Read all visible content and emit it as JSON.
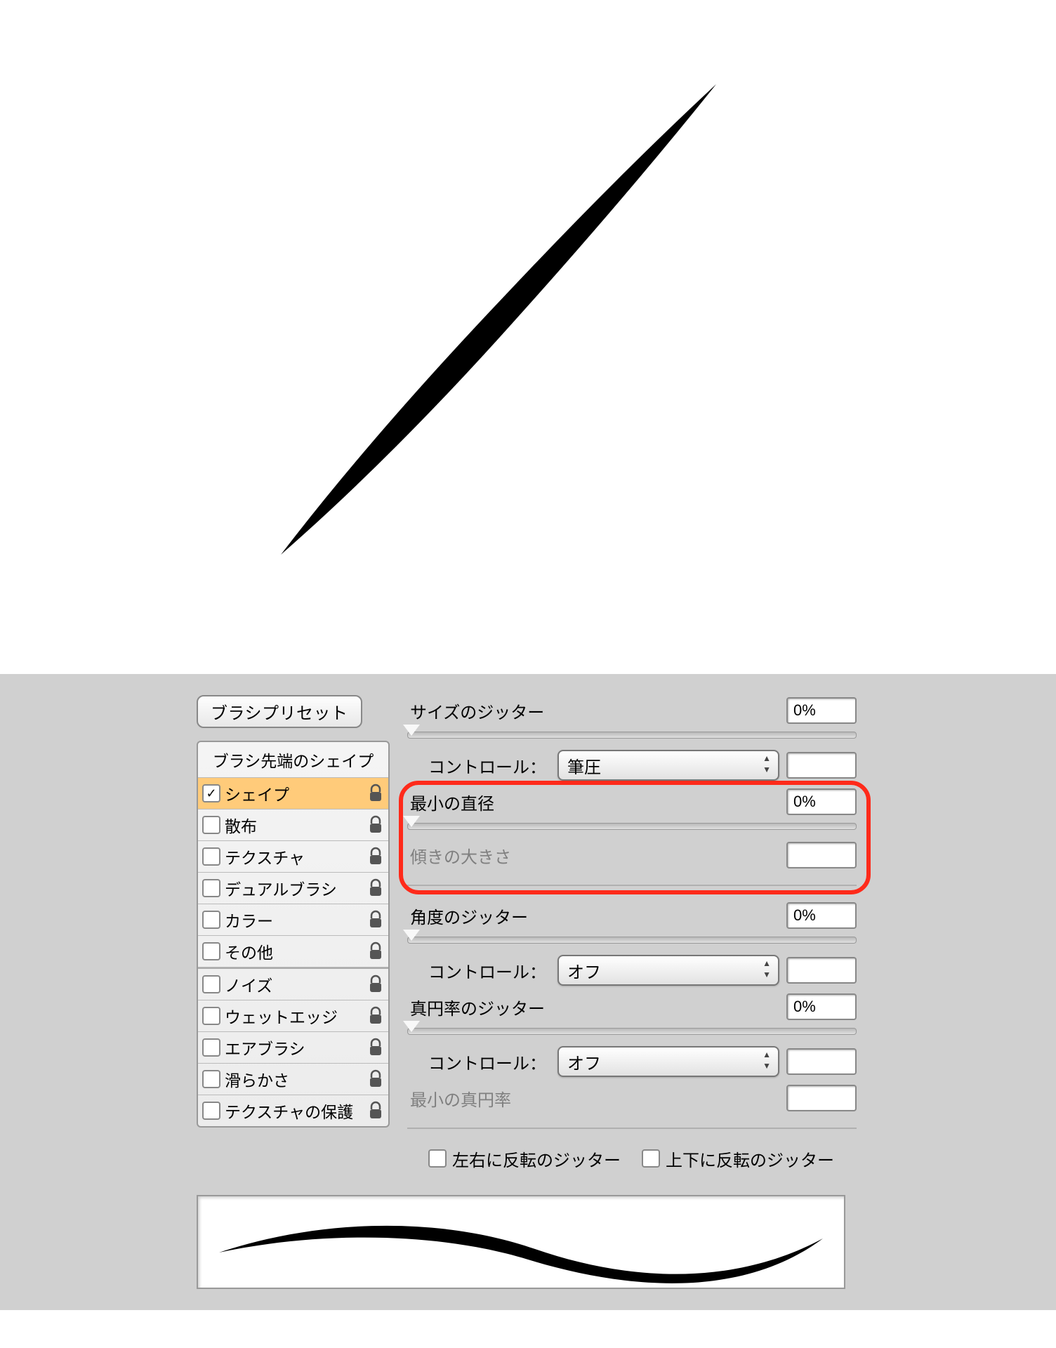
{
  "preset_button": "ブラシプリセット",
  "sidebar": {
    "header": "ブラシ先端のシェイプ",
    "rows": [
      {
        "label": "シェイプ",
        "checked": true,
        "locked": true,
        "selected": true
      },
      {
        "label": "散布",
        "checked": false,
        "locked": true,
        "selected": false
      },
      {
        "label": "テクスチャ",
        "checked": false,
        "locked": true,
        "selected": false
      },
      {
        "label": "デュアルブラシ",
        "checked": false,
        "locked": true,
        "selected": false
      },
      {
        "label": "カラー",
        "checked": false,
        "locked": true,
        "selected": false
      },
      {
        "label": "その他",
        "checked": false,
        "locked": true,
        "selected": false
      },
      {
        "label": "ノイズ",
        "checked": false,
        "locked": true,
        "selected": false,
        "divider": true
      },
      {
        "label": "ウェットエッジ",
        "checked": false,
        "locked": true,
        "selected": false
      },
      {
        "label": "エアブラシ",
        "checked": false,
        "locked": true,
        "selected": false
      },
      {
        "label": "滑らかさ",
        "checked": false,
        "locked": true,
        "selected": false
      },
      {
        "label": "テクスチャの保護",
        "checked": false,
        "locked": true,
        "selected": false
      }
    ]
  },
  "settings": {
    "size_jitter_label": "サイズのジッター",
    "size_jitter_value": "0%",
    "control_label": "コントロール：",
    "control_pen": "筆圧",
    "min_diameter_label": "最小の直径",
    "min_diameter_value": "0%",
    "tilt_label": "傾きの大きさ",
    "tilt_value": "",
    "angle_jitter_label": "角度のジッター",
    "angle_jitter_value": "0%",
    "control_off": "オフ",
    "roundness_jitter_label": "真円率のジッター",
    "roundness_jitter_value": "0%",
    "min_roundness_label": "最小の真円率",
    "min_roundness_value": "",
    "flip_x_label": "左右に反転のジッター",
    "flip_y_label": "上下に反転のジッター"
  }
}
